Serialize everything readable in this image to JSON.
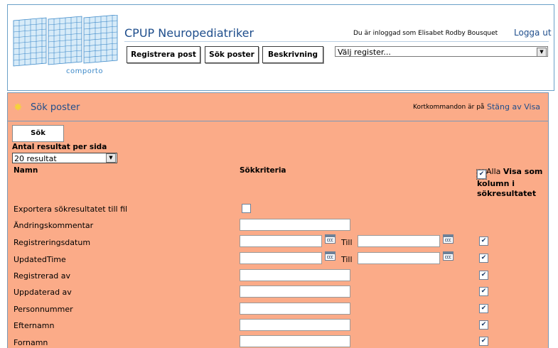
{
  "header": {
    "logo_text": "comporto",
    "app_title": "CPUP Neuropediatriker",
    "user_info": "Du är inloggad som Elisabet Rodby Bousquet",
    "logout": "Logga ut",
    "buttons": {
      "register": "Registrera post",
      "search": "Sök poster",
      "description": "Beskrivning"
    },
    "register_select": "Välj register..."
  },
  "panel": {
    "icon": "star-icon",
    "title": "Sök poster",
    "shortcut_text": "Kortkommandon är på",
    "shortcut_link": "Stäng av Visa"
  },
  "form": {
    "search_button": "Sök",
    "per_page_label": "Antal resultat per sida",
    "per_page_value": "20 resultat",
    "col_name": "Namn",
    "col_criteria": "Sökkriteria",
    "col_show_all": "Alla",
    "col_show": "Visa som kolumn i sökresultatet",
    "till": "Till",
    "rows": [
      {
        "label": "Exportera sökresultatet till fil",
        "type": "checkbox",
        "checked": false
      },
      {
        "label": "Ändringskommentar",
        "type": "text",
        "show": null
      },
      {
        "label": "Registreringsdatum",
        "type": "daterange",
        "show": true
      },
      {
        "label": "UpdatedTime",
        "type": "daterange",
        "show": true
      },
      {
        "label": "Registrerad av",
        "type": "text",
        "show": true
      },
      {
        "label": "Uppdaterad av",
        "type": "text",
        "show": true
      },
      {
        "label": "Personnummer",
        "type": "text",
        "show": true
      },
      {
        "label": "Efternamn",
        "type": "text",
        "show": true
      },
      {
        "label": "Fornamn",
        "type": "text",
        "show": true
      }
    ]
  },
  "colors": {
    "panel_bg": "#fbab88",
    "link": "#1f4e8c",
    "border": "#7a99b8"
  }
}
